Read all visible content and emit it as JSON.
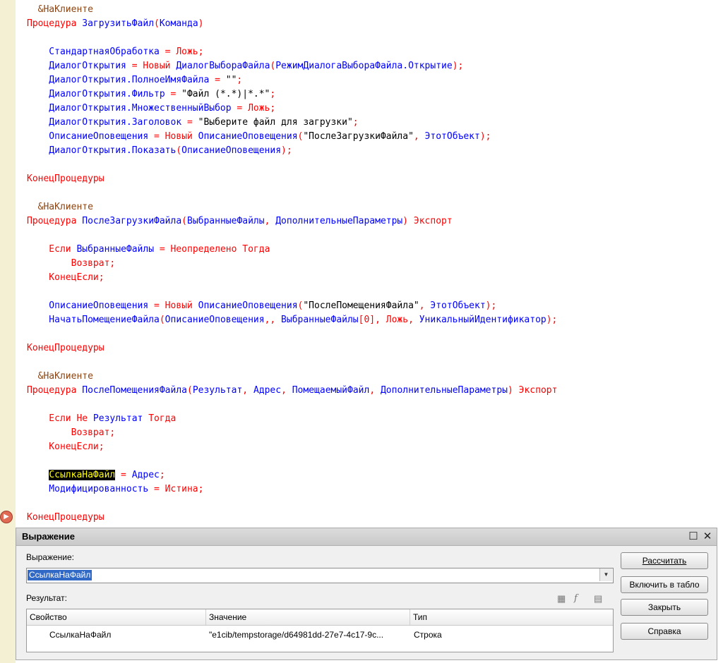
{
  "code_lines": [
    [
      {
        "c": "pp",
        "t": "  &НаКлиенте"
      }
    ],
    [
      {
        "c": "kw",
        "t": "Процедура "
      },
      {
        "c": "id",
        "t": "ЗагрузитьФайл"
      },
      {
        "c": "kw",
        "t": "("
      },
      {
        "c": "id",
        "t": "Команда"
      },
      {
        "c": "kw",
        "t": ")"
      }
    ],
    [],
    [
      {
        "c": "id",
        "t": "    СтандартнаяОбработка"
      },
      {
        "c": "kw",
        "t": " = Ложь;"
      }
    ],
    [
      {
        "c": "id",
        "t": "    ДиалогОткрытия"
      },
      {
        "c": "kw",
        "t": " = Новый "
      },
      {
        "c": "id",
        "t": "ДиалогВыбораФайла"
      },
      {
        "c": "kw",
        "t": "("
      },
      {
        "c": "id",
        "t": "РежимДиалогаВыбораФайла.Открытие"
      },
      {
        "c": "kw",
        "t": ");"
      }
    ],
    [
      {
        "c": "id",
        "t": "    ДиалогОткрытия.ПолноеИмяФайла"
      },
      {
        "c": "kw",
        "t": " = "
      },
      {
        "c": "st",
        "t": "\"\""
      },
      {
        "c": "kw",
        "t": ";"
      }
    ],
    [
      {
        "c": "id",
        "t": "    ДиалогОткрытия.Фильтр"
      },
      {
        "c": "kw",
        "t": " = "
      },
      {
        "c": "st",
        "t": "\"Файл (*.*)|*.*\""
      },
      {
        "c": "kw",
        "t": ";"
      }
    ],
    [
      {
        "c": "id",
        "t": "    ДиалогОткрытия.МножественныйВыбор"
      },
      {
        "c": "kw",
        "t": " = Ложь;"
      }
    ],
    [
      {
        "c": "id",
        "t": "    ДиалогОткрытия.Заголовок"
      },
      {
        "c": "kw",
        "t": " = "
      },
      {
        "c": "st",
        "t": "\"Выберите файл для загрузки\""
      },
      {
        "c": "kw",
        "t": ";"
      }
    ],
    [
      {
        "c": "id",
        "t": "    ОписаниеОповещения"
      },
      {
        "c": "kw",
        "t": " = Новый "
      },
      {
        "c": "id",
        "t": "ОписаниеОповещения"
      },
      {
        "c": "kw",
        "t": "("
      },
      {
        "c": "st",
        "t": "\"ПослеЗагрузкиФайла\""
      },
      {
        "c": "kw",
        "t": ", "
      },
      {
        "c": "id",
        "t": "ЭтотОбъект"
      },
      {
        "c": "kw",
        "t": ");"
      }
    ],
    [
      {
        "c": "id",
        "t": "    ДиалогОткрытия.Показать"
      },
      {
        "c": "kw",
        "t": "("
      },
      {
        "c": "id",
        "t": "ОписаниеОповещения"
      },
      {
        "c": "kw",
        "t": ");"
      }
    ],
    [],
    [
      {
        "c": "kw",
        "t": "КонецПроцедуры"
      }
    ],
    [],
    [
      {
        "c": "pp",
        "t": "  &НаКлиенте"
      }
    ],
    [
      {
        "c": "kw",
        "t": "Процедура "
      },
      {
        "c": "id",
        "t": "ПослеЗагрузкиФайла"
      },
      {
        "c": "kw",
        "t": "("
      },
      {
        "c": "id",
        "t": "ВыбранныеФайлы"
      },
      {
        "c": "kw",
        "t": ", "
      },
      {
        "c": "id",
        "t": "ДополнительныеПараметры"
      },
      {
        "c": "kw",
        "t": ") Экспорт"
      }
    ],
    [],
    [
      {
        "c": "kw",
        "t": "    Если "
      },
      {
        "c": "id",
        "t": "ВыбранныеФайлы"
      },
      {
        "c": "kw",
        "t": " = Неопределено Тогда"
      }
    ],
    [
      {
        "c": "kw",
        "t": "        Возврат;"
      }
    ],
    [
      {
        "c": "kw",
        "t": "    КонецЕсли;"
      }
    ],
    [],
    [
      {
        "c": "id",
        "t": "    ОписаниеОповещения"
      },
      {
        "c": "kw",
        "t": " = Новый "
      },
      {
        "c": "id",
        "t": "ОписаниеОповещения"
      },
      {
        "c": "kw",
        "t": "("
      },
      {
        "c": "st",
        "t": "\"ПослеПомещенияФайла\""
      },
      {
        "c": "kw",
        "t": ", "
      },
      {
        "c": "id",
        "t": "ЭтотОбъект"
      },
      {
        "c": "kw",
        "t": ");"
      }
    ],
    [
      {
        "c": "id",
        "t": "    НачатьПомещениеФайла"
      },
      {
        "c": "kw",
        "t": "("
      },
      {
        "c": "id",
        "t": "ОписаниеОповещения"
      },
      {
        "c": "kw",
        "t": ",, "
      },
      {
        "c": "id",
        "t": "ВыбранныеФайлы"
      },
      {
        "c": "kw",
        "t": "[0], Ложь, "
      },
      {
        "c": "id",
        "t": "УникальныйИдентификатор"
      },
      {
        "c": "kw",
        "t": ");"
      }
    ],
    [],
    [
      {
        "c": "kw",
        "t": "КонецПроцедуры"
      }
    ],
    [],
    [
      {
        "c": "pp",
        "t": "  &НаКлиенте"
      }
    ],
    [
      {
        "c": "kw",
        "t": "Процедура "
      },
      {
        "c": "id",
        "t": "ПослеПомещенияФайла"
      },
      {
        "c": "kw",
        "t": "("
      },
      {
        "c": "id",
        "t": "Результат"
      },
      {
        "c": "kw",
        "t": ", "
      },
      {
        "c": "id",
        "t": "Адрес"
      },
      {
        "c": "kw",
        "t": ", "
      },
      {
        "c": "id",
        "t": "ПомещаемыйФайл"
      },
      {
        "c": "kw",
        "t": ", "
      },
      {
        "c": "id",
        "t": "ДополнительныеПараметры"
      },
      {
        "c": "kw",
        "t": ") Экспорт"
      }
    ],
    [],
    [
      {
        "c": "kw",
        "t": "    Если Не "
      },
      {
        "c": "id",
        "t": "Результат"
      },
      {
        "c": "kw",
        "t": " Тогда"
      }
    ],
    [
      {
        "c": "kw",
        "t": "        Возврат;"
      }
    ],
    [
      {
        "c": "kw",
        "t": "    КонецЕсли;"
      }
    ],
    [],
    [
      {
        "c": "st",
        "t": "    "
      },
      {
        "c": "hl",
        "t": "СсылкаНаФайл"
      },
      {
        "c": "kw",
        "t": " = "
      },
      {
        "c": "id",
        "t": "Адрес"
      },
      {
        "c": "kw",
        "t": ";"
      }
    ],
    [
      {
        "c": "id",
        "t": "    Модифицированность"
      },
      {
        "c": "kw",
        "t": " = Истина;"
      }
    ],
    [],
    [
      {
        "c": "kw",
        "t": "КонецПроцедуры"
      }
    ]
  ],
  "dialog": {
    "title": "Выражение",
    "maximize_glyph": "☐",
    "close_glyph": "✕",
    "expression_label": "Выражение:",
    "expression_value": "СсылкаНаФайл",
    "result_label": "Результат:",
    "columns": [
      "Свойство",
      "Значение",
      "Тип"
    ],
    "rows": [
      {
        "property": "СсылкаНаФайл",
        "value": "\"e1cib/tempstorage/d64981dd-27e7-4c17-9c...",
        "type": "Строка"
      }
    ],
    "buttons": {
      "calculate": "Рассчитать",
      "add_to_board": "Включить в табло",
      "close": "Закрыть",
      "help": "Справка"
    }
  }
}
